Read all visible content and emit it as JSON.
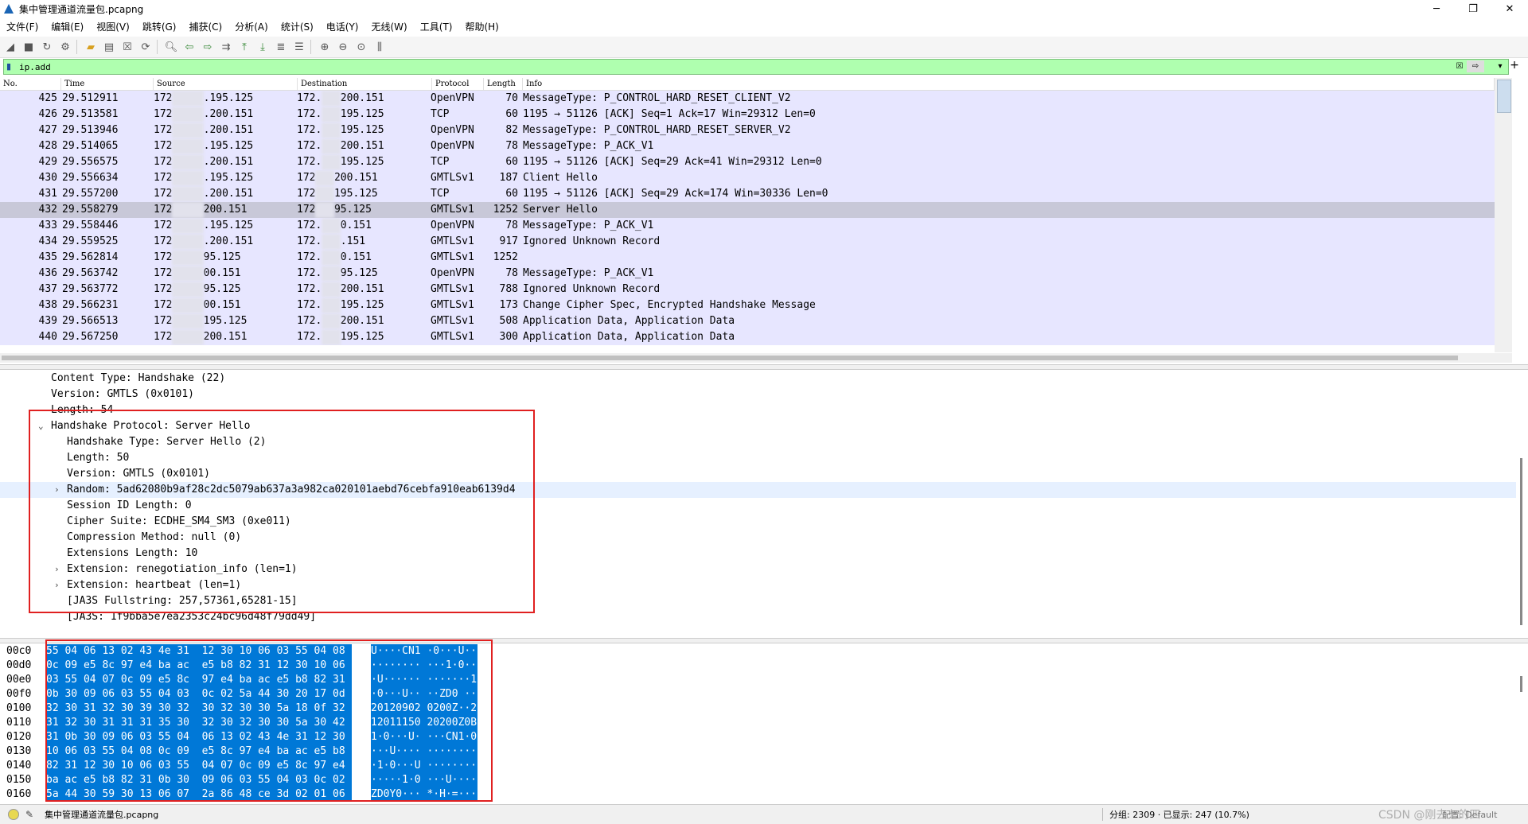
{
  "window": {
    "title": "集中管理通道流量包.pcapng",
    "minimize": "─",
    "maximize": "❐",
    "close": "✕"
  },
  "menu": [
    "文件(F)",
    "编辑(E)",
    "视图(V)",
    "跳转(G)",
    "捕获(C)",
    "分析(A)",
    "统计(S)",
    "电话(Y)",
    "无线(W)",
    "工具(T)",
    "帮助(H)"
  ],
  "filter": {
    "value": "ip.add"
  },
  "packet_list": {
    "columns": [
      "No.",
      "Time",
      "Source",
      "Destination",
      "Protocol",
      "Length",
      "Info"
    ],
    "rows": [
      {
        "no": "425",
        "time": "29.512911",
        "src_a": "172",
        "src_b": ".195.125",
        "dst_a": "172.",
        "dst_b": "200.151",
        "proto": "OpenVPN",
        "len": "70",
        "info": "MessageType: P_CONTROL_HARD_RESET_CLIENT_V2"
      },
      {
        "no": "426",
        "time": "29.513581",
        "src_a": "172",
        "src_b": ".200.151",
        "dst_a": "172.",
        "dst_b": "195.125",
        "proto": "TCP",
        "len": "60",
        "info": "1195 → 51126 [ACK] Seq=1 Ack=17 Win=29312 Len=0"
      },
      {
        "no": "427",
        "time": "29.513946",
        "src_a": "172",
        "src_b": ".200.151",
        "dst_a": "172.",
        "dst_b": "195.125",
        "proto": "OpenVPN",
        "len": "82",
        "info": "MessageType: P_CONTROL_HARD_RESET_SERVER_V2"
      },
      {
        "no": "428",
        "time": "29.514065",
        "src_a": "172",
        "src_b": ".195.125",
        "dst_a": "172.",
        "dst_b": "200.151",
        "proto": "OpenVPN",
        "len": "78",
        "info": "MessageType: P_ACK_V1"
      },
      {
        "no": "429",
        "time": "29.556575",
        "src_a": "172",
        "src_b": ".200.151",
        "dst_a": "172.",
        "dst_b": "195.125",
        "proto": "TCP",
        "len": "60",
        "info": "1195 → 51126 [ACK] Seq=29 Ack=41 Win=29312 Len=0"
      },
      {
        "no": "430",
        "time": "29.556634",
        "src_a": "172",
        "src_b": ".195.125",
        "dst_a": "172",
        "dst_b": "200.151",
        "proto": "GMTLSv1",
        "len": "187",
        "info": "Client Hello"
      },
      {
        "no": "431",
        "time": "29.557200",
        "src_a": "172",
        "src_b": ".200.151",
        "dst_a": "172",
        "dst_b": "195.125",
        "proto": "TCP",
        "len": "60",
        "info": "1195 → 51126 [ACK] Seq=29 Ack=174 Win=30336 Len=0"
      },
      {
        "no": "432",
        "time": "29.558279",
        "src_a": "172",
        "src_b": "200.151",
        "dst_a": "172",
        "dst_b": "95.125",
        "proto": "GMTLSv1",
        "len": "1252",
        "info": "Server Hello"
      },
      {
        "no": "433",
        "time": "29.558446",
        "src_a": "172",
        "src_b": ".195.125",
        "dst_a": "172.",
        "dst_b": "0.151",
        "proto": "OpenVPN",
        "len": "78",
        "info": "MessageType: P_ACK_V1"
      },
      {
        "no": "434",
        "time": "29.559525",
        "src_a": "172",
        "src_b": ".200.151",
        "dst_a": "172.",
        "dst_b": ".151",
        "proto": "GMTLSv1",
        "len": "917",
        "info": "Ignored Unknown Record"
      },
      {
        "no": "435",
        "time": "29.562814",
        "src_a": "172",
        "src_b": "95.125",
        "dst_a": "172.",
        "dst_b": "0.151",
        "proto": "GMTLSv1",
        "len": "1252",
        "info": ""
      },
      {
        "no": "436",
        "time": "29.563742",
        "src_a": "172",
        "src_b": "00.151",
        "dst_a": "172.",
        "dst_b": "95.125",
        "proto": "OpenVPN",
        "len": "78",
        "info": "MessageType: P_ACK_V1"
      },
      {
        "no": "437",
        "time": "29.563772",
        "src_a": "172",
        "src_b": "95.125",
        "dst_a": "172.",
        "dst_b": "200.151",
        "proto": "GMTLSv1",
        "len": "788",
        "info": "Ignored Unknown Record"
      },
      {
        "no": "438",
        "time": "29.566231",
        "src_a": "172",
        "src_b": "00.151",
        "dst_a": "172.",
        "dst_b": "195.125",
        "proto": "GMTLSv1",
        "len": "173",
        "info": "Change Cipher Spec, Encrypted Handshake Message"
      },
      {
        "no": "439",
        "time": "29.566513",
        "src_a": "172",
        "src_b": "195.125",
        "dst_a": "172.",
        "dst_b": "200.151",
        "proto": "GMTLSv1",
        "len": "508",
        "info": "Application Data, Application Data"
      },
      {
        "no": "440",
        "time": "29.567250",
        "src_a": "172",
        "src_b": "200.151",
        "dst_a": "172.",
        "dst_b": "195.125",
        "proto": "GMTLSv1",
        "len": "300",
        "info": "Application Data, Application Data"
      }
    ]
  },
  "details": [
    {
      "text": "Content Type: Handshake (22)",
      "indent": 0,
      "arrow": ""
    },
    {
      "text": "Version: GMTLS (0x0101)",
      "indent": 0,
      "arrow": ""
    },
    {
      "text": "Length: 54",
      "indent": 0,
      "arrow": ""
    },
    {
      "text": "Handshake Protocol: Server Hello",
      "indent": 0,
      "arrow": "⌄"
    },
    {
      "text": "Handshake Type: Server Hello (2)",
      "indent": 1,
      "arrow": ""
    },
    {
      "text": "Length: 50",
      "indent": 1,
      "arrow": ""
    },
    {
      "text": "Version: GMTLS (0x0101)",
      "indent": 1,
      "arrow": ""
    },
    {
      "text": "Random: 5ad62080b9af28c2dc5079ab637a3a982ca020101aebd76cebfa910eab6139d4",
      "indent": 1,
      "arrow": "›"
    },
    {
      "text": "Session ID Length: 0",
      "indent": 1,
      "arrow": ""
    },
    {
      "text": "Cipher Suite: ECDHE_SM4_SM3 (0xe011)",
      "indent": 1,
      "arrow": ""
    },
    {
      "text": "Compression Method: null (0)",
      "indent": 1,
      "arrow": ""
    },
    {
      "text": "Extensions Length: 10",
      "indent": 1,
      "arrow": ""
    },
    {
      "text": "Extension: renegotiation_info (len=1)",
      "indent": 1,
      "arrow": "›"
    },
    {
      "text": "Extension: heartbeat (len=1)",
      "indent": 1,
      "arrow": "›"
    },
    {
      "text": "[JA3S Fullstring: 257,57361,65281-15]",
      "indent": 1,
      "arrow": ""
    },
    {
      "text": "[JA3S: 1f9bba5e7ea2353c24bc96d48f79dd49]",
      "indent": 1,
      "arrow": ""
    }
  ],
  "bytes": [
    {
      "off": "00c0",
      "hex": "55 04 06 13 02 43 4e 31  12 30 10 06 03 55 04 08",
      "asc": "U····CN1 ·0···U··"
    },
    {
      "off": "00d0",
      "hex": "0c 09 e5 8c 97 e4 ba ac  e5 b8 82 31 12 30 10 06",
      "asc": "········ ···1·0··"
    },
    {
      "off": "00e0",
      "hex": "03 55 04 07 0c 09 e5 8c  97 e4 ba ac e5 b8 82 31",
      "asc": "·U······ ·······1"
    },
    {
      "off": "00f0",
      "hex": "0b 30 09 06 03 55 04 03  0c 02 5a 44 30 20 17 0d",
      "asc": "·0···U·· ··ZD0 ··"
    },
    {
      "off": "0100",
      "hex": "32 30 31 32 30 39 30 32  30 32 30 30 5a 18 0f 32",
      "asc": "20120902 0200Z··2"
    },
    {
      "off": "0110",
      "hex": "31 32 30 31 31 31 35 30  32 30 32 30 30 5a 30 42",
      "asc": "12011150 20200Z0B"
    },
    {
      "off": "0120",
      "hex": "31 0b 30 09 06 03 55 04  06 13 02 43 4e 31 12 30",
      "asc": "1·0···U· ···CN1·0"
    },
    {
      "off": "0130",
      "hex": "10 06 03 55 04 08 0c 09  e5 8c 97 e4 ba ac e5 b8",
      "asc": "···U···· ········"
    },
    {
      "off": "0140",
      "hex": "82 31 12 30 10 06 03 55  04 07 0c 09 e5 8c 97 e4",
      "asc": "·1·0···U ········"
    },
    {
      "off": "0150",
      "hex": "ba ac e5 b8 82 31 0b 30  09 06 03 55 04 03 0c 02",
      "asc": "·····1·0 ···U····"
    },
    {
      "off": "0160",
      "hex": "5a 44 30 59 30 13 06 07  2a 86 48 ce 3d 02 01 06",
      "asc": "ZD0Y0··· *·H·=···"
    }
  ],
  "status": {
    "file": "集中管理通道流量包.pcapng",
    "packets": "分组: 2309 · 已显示: 247 (10.7%)",
    "profile": "配置: Default",
    "watermark": "CSDN @刚去七的四"
  },
  "colors": {
    "row_bg": "#e7e6ff",
    "row_selected": "#c8c8d8",
    "filter_bg": "#afffaf",
    "bytes_highlight": "#0078d7",
    "annotation_box": "#e02020"
  }
}
